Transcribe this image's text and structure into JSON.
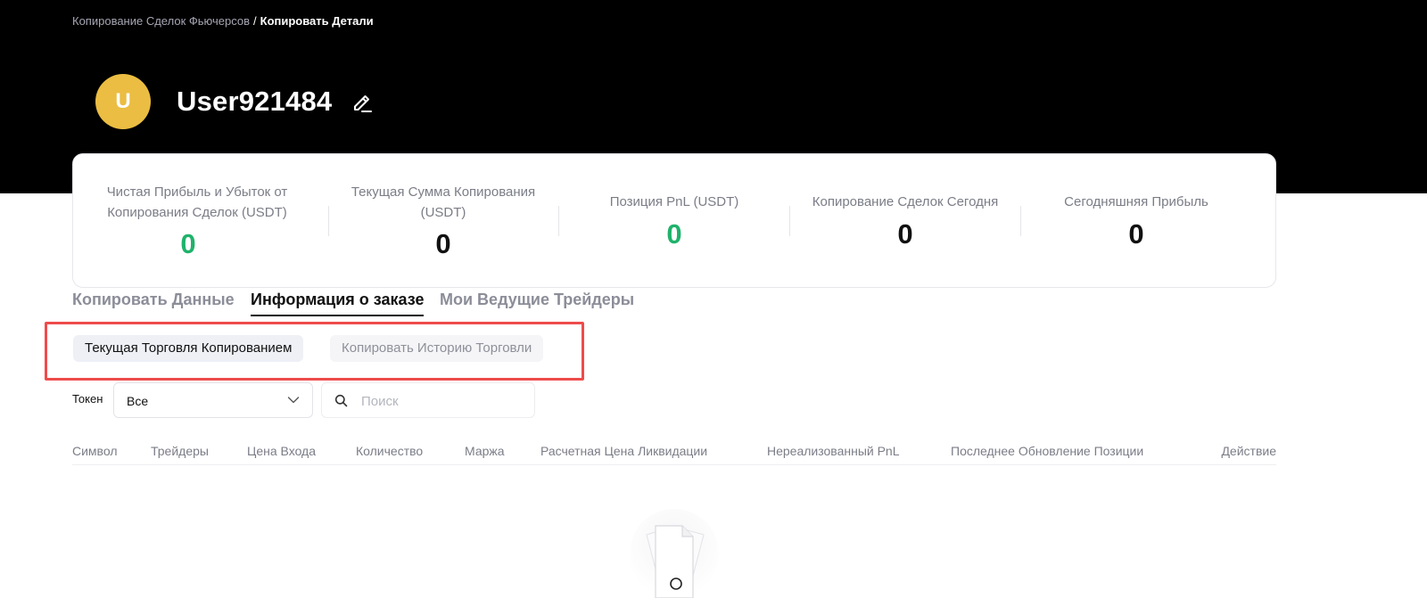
{
  "breadcrumb": {
    "parent": "Копирование Сделок Фьючерсов",
    "separator": "/",
    "current": "Копировать Детали"
  },
  "profile": {
    "avatar_letter": "U",
    "avatar_color": "#ebbd42",
    "username": "User921484",
    "edit_icon": "pencil-edit-icon"
  },
  "stats": [
    {
      "label": "Чистая Прибыль и Убыток от Копирования Сделок (USDT)",
      "value": "0",
      "color": "#1fb26b"
    },
    {
      "label": "Текущая Сумма Копирования (USDT)",
      "value": "0",
      "color": "#111111"
    },
    {
      "label": "Позиция PnL (USDT)",
      "value": "0",
      "color": "#1fb26b"
    },
    {
      "label": "Копирование Сделок Сегодня",
      "value": "0",
      "color": "#111111"
    },
    {
      "label": "Сегодняшняя Прибыль",
      "value": "0",
      "color": "#111111"
    }
  ],
  "tabs": [
    {
      "label": "Копировать Данные",
      "active": false
    },
    {
      "label": "Информация о заказе",
      "active": true
    },
    {
      "label": "Мои Ведущие Трейдеры",
      "active": false
    }
  ],
  "subtabs": [
    {
      "label": "Текущая Торговля Копированием",
      "active": true
    },
    {
      "label": "Копировать Историю Торговли",
      "active": false
    }
  ],
  "filters": {
    "token_label": "Токен",
    "token_value": "Все",
    "search_placeholder": "Поиск"
  },
  "table": {
    "columns": [
      "Символ",
      "Трейдеры",
      "Цена Входа",
      "Количество",
      "Маржа",
      "Расчетная Цена Ликвидации",
      "Нереализованный PnL",
      "Последнее Обновление Позиции",
      "Действие"
    ],
    "rows": []
  },
  "colors": {
    "hero_bg": "#000000",
    "accent_green": "#1fb26b",
    "highlight_red": "#ee4b4b"
  }
}
